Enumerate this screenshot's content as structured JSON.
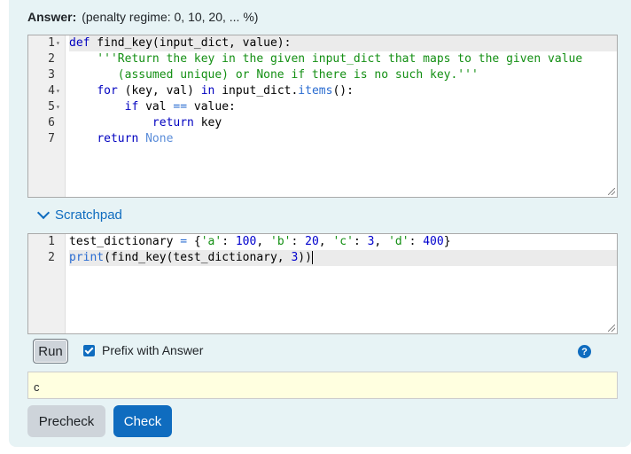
{
  "answer": {
    "label": "Answer:",
    "penalty": "(penalty regime: 0, 10, 20, ... %)"
  },
  "editor": {
    "line_numbers": [
      "1",
      "2",
      "3",
      "4",
      "5",
      "6",
      "7"
    ],
    "lines": [
      [
        {
          "t": "def",
          "c": "kw"
        },
        {
          "t": " find_key(input_dict, value):",
          "c": ""
        }
      ],
      [
        {
          "t": "    '''Return the key in the given input_dict that maps to the given value",
          "c": "str"
        }
      ],
      [
        {
          "t": "       (assumed unique) or None if there is no such key.'''",
          "c": "str"
        }
      ],
      [
        {
          "t": "    ",
          "c": ""
        },
        {
          "t": "for",
          "c": "kw"
        },
        {
          "t": " (key, val) ",
          "c": ""
        },
        {
          "t": "in",
          "c": "kw"
        },
        {
          "t": " input_dict.",
          "c": ""
        },
        {
          "t": "items",
          "c": "bi"
        },
        {
          "t": "():",
          "c": ""
        }
      ],
      [
        {
          "t": "        ",
          "c": ""
        },
        {
          "t": "if",
          "c": "kw"
        },
        {
          "t": " val ",
          "c": ""
        },
        {
          "t": "==",
          "c": "bi"
        },
        {
          "t": " value:",
          "c": ""
        }
      ],
      [
        {
          "t": "            ",
          "c": ""
        },
        {
          "t": "return",
          "c": "kw"
        },
        {
          "t": " key",
          "c": ""
        }
      ],
      [
        {
          "t": "    ",
          "c": ""
        },
        {
          "t": "return",
          "c": "kw"
        },
        {
          "t": " ",
          "c": ""
        },
        {
          "t": "None",
          "c": "cst"
        }
      ]
    ]
  },
  "scratchpad": {
    "title": "Scratchpad",
    "line_numbers": [
      "1",
      "2"
    ],
    "lines": [
      [
        {
          "t": "test_dictionary ",
          "c": ""
        },
        {
          "t": "=",
          "c": "bi"
        },
        {
          "t": " {",
          "c": ""
        },
        {
          "t": "'a'",
          "c": "str"
        },
        {
          "t": ": ",
          "c": ""
        },
        {
          "t": "100",
          "c": "num"
        },
        {
          "t": ", ",
          "c": ""
        },
        {
          "t": "'b'",
          "c": "str"
        },
        {
          "t": ": ",
          "c": ""
        },
        {
          "t": "20",
          "c": "num"
        },
        {
          "t": ", ",
          "c": ""
        },
        {
          "t": "'c'",
          "c": "str"
        },
        {
          "t": ": ",
          "c": ""
        },
        {
          "t": "3",
          "c": "num"
        },
        {
          "t": ", ",
          "c": ""
        },
        {
          "t": "'d'",
          "c": "str"
        },
        {
          "t": ": ",
          "c": ""
        },
        {
          "t": "400",
          "c": "num"
        },
        {
          "t": "}",
          "c": ""
        }
      ],
      [
        {
          "t": "print",
          "c": "bi"
        },
        {
          "t": "(find_key(test_dictionary, ",
          "c": ""
        },
        {
          "t": "3",
          "c": "num"
        },
        {
          "t": "))",
          "c": ""
        }
      ]
    ],
    "run_label": "Run",
    "prefix_label": "Prefix with Answer",
    "prefix_checked": true,
    "help_icon": "?",
    "output": "c"
  },
  "buttons": {
    "precheck": "Precheck",
    "check": "Check"
  },
  "colors": {
    "accent": "#0f6cbf",
    "panel": "#e7f3f5",
    "output_bg": "#ffffe0"
  }
}
